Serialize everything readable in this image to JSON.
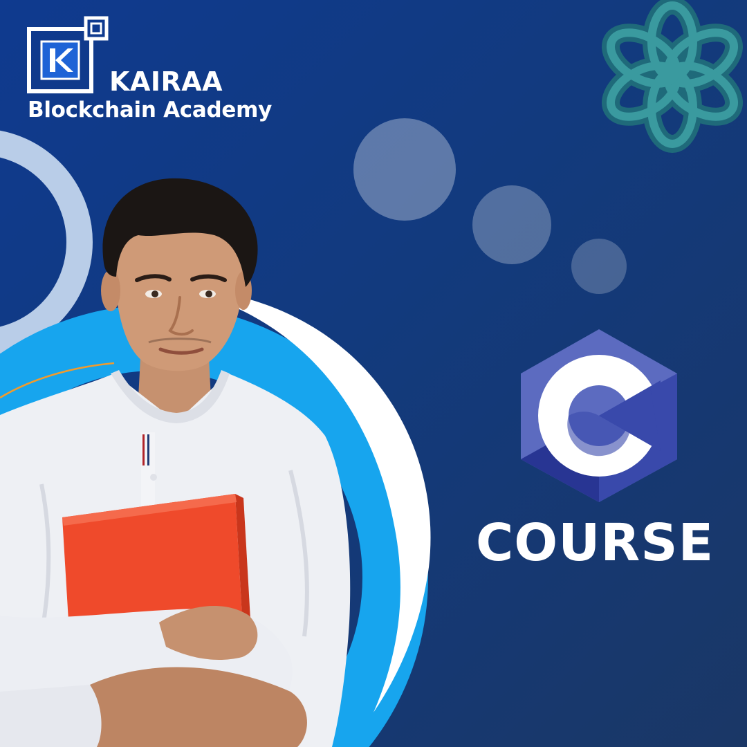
{
  "brand": {
    "logo_icon": "kairaa-k-logo-icon",
    "name": "KAIRAA",
    "subtitle": "Blockchain Academy"
  },
  "hero": {
    "language_logo_icon": "c-language-hexagon-icon",
    "course_label": "COURSE",
    "person_image": "student-holding-red-folder"
  },
  "decor": {
    "knot_icon": "teal-flower-knot-icon"
  },
  "colors": {
    "background": "#123a7e",
    "accent_cyan": "#1aa6ec",
    "hex_light": "#5c6bc0",
    "hex_dark": "#3949ab",
    "folder_red": "#ef4a2b",
    "text": "#ffffff"
  }
}
